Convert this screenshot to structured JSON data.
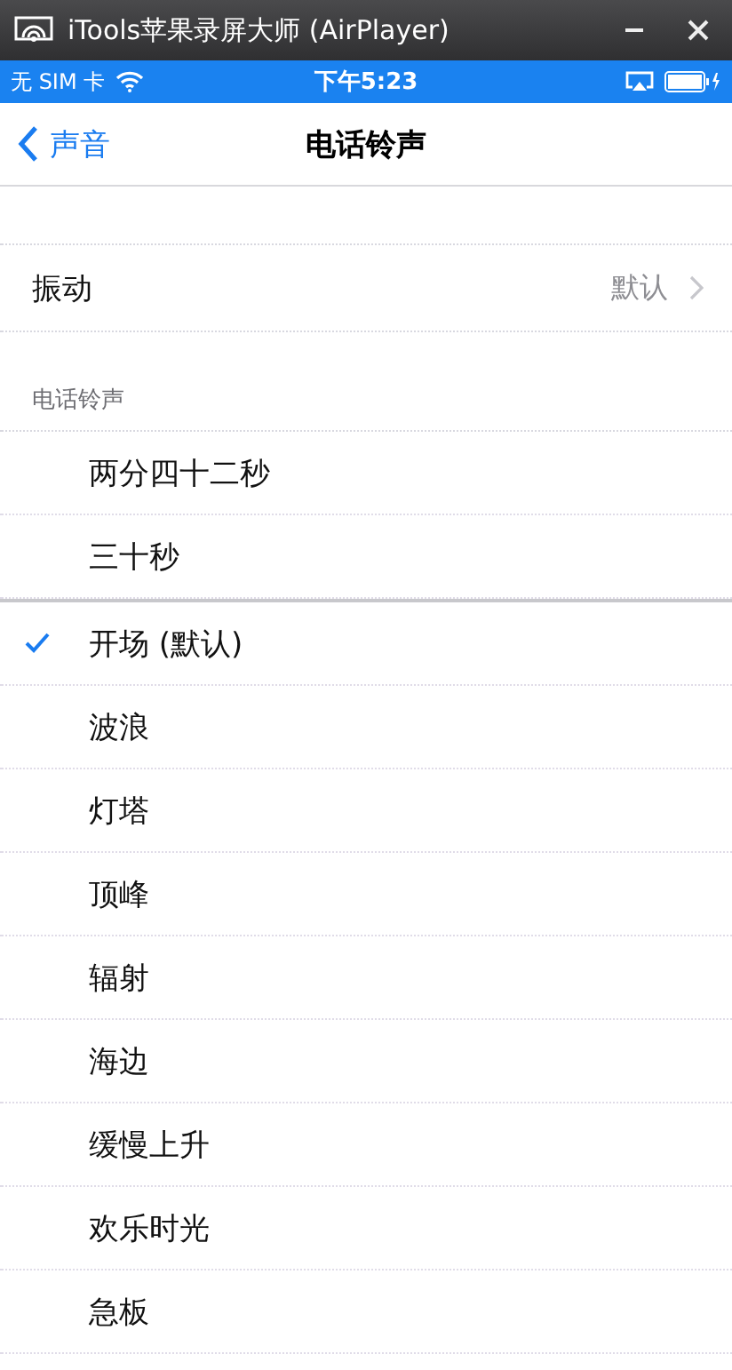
{
  "window": {
    "title": "iTools苹果录屏大师 (AirPlayer)"
  },
  "status_bar": {
    "carrier": "无 SIM 卡",
    "time": "下午5:23"
  },
  "nav": {
    "back": "声音",
    "title": "电话铃声"
  },
  "vibration": {
    "label": "振动",
    "value": "默认"
  },
  "section": {
    "header": "电话铃声"
  },
  "custom_tones": [
    {
      "label": "两分四十二秒",
      "selected": false
    },
    {
      "label": "三十秒",
      "selected": false
    }
  ],
  "tones": [
    {
      "label": "开场 (默认)",
      "selected": true
    },
    {
      "label": "波浪",
      "selected": false
    },
    {
      "label": "灯塔",
      "selected": false
    },
    {
      "label": "顶峰",
      "selected": false
    },
    {
      "label": "辐射",
      "selected": false
    },
    {
      "label": "海边",
      "selected": false
    },
    {
      "label": "缓慢上升",
      "selected": false
    },
    {
      "label": "欢乐时光",
      "selected": false
    },
    {
      "label": "急板",
      "selected": false
    }
  ]
}
